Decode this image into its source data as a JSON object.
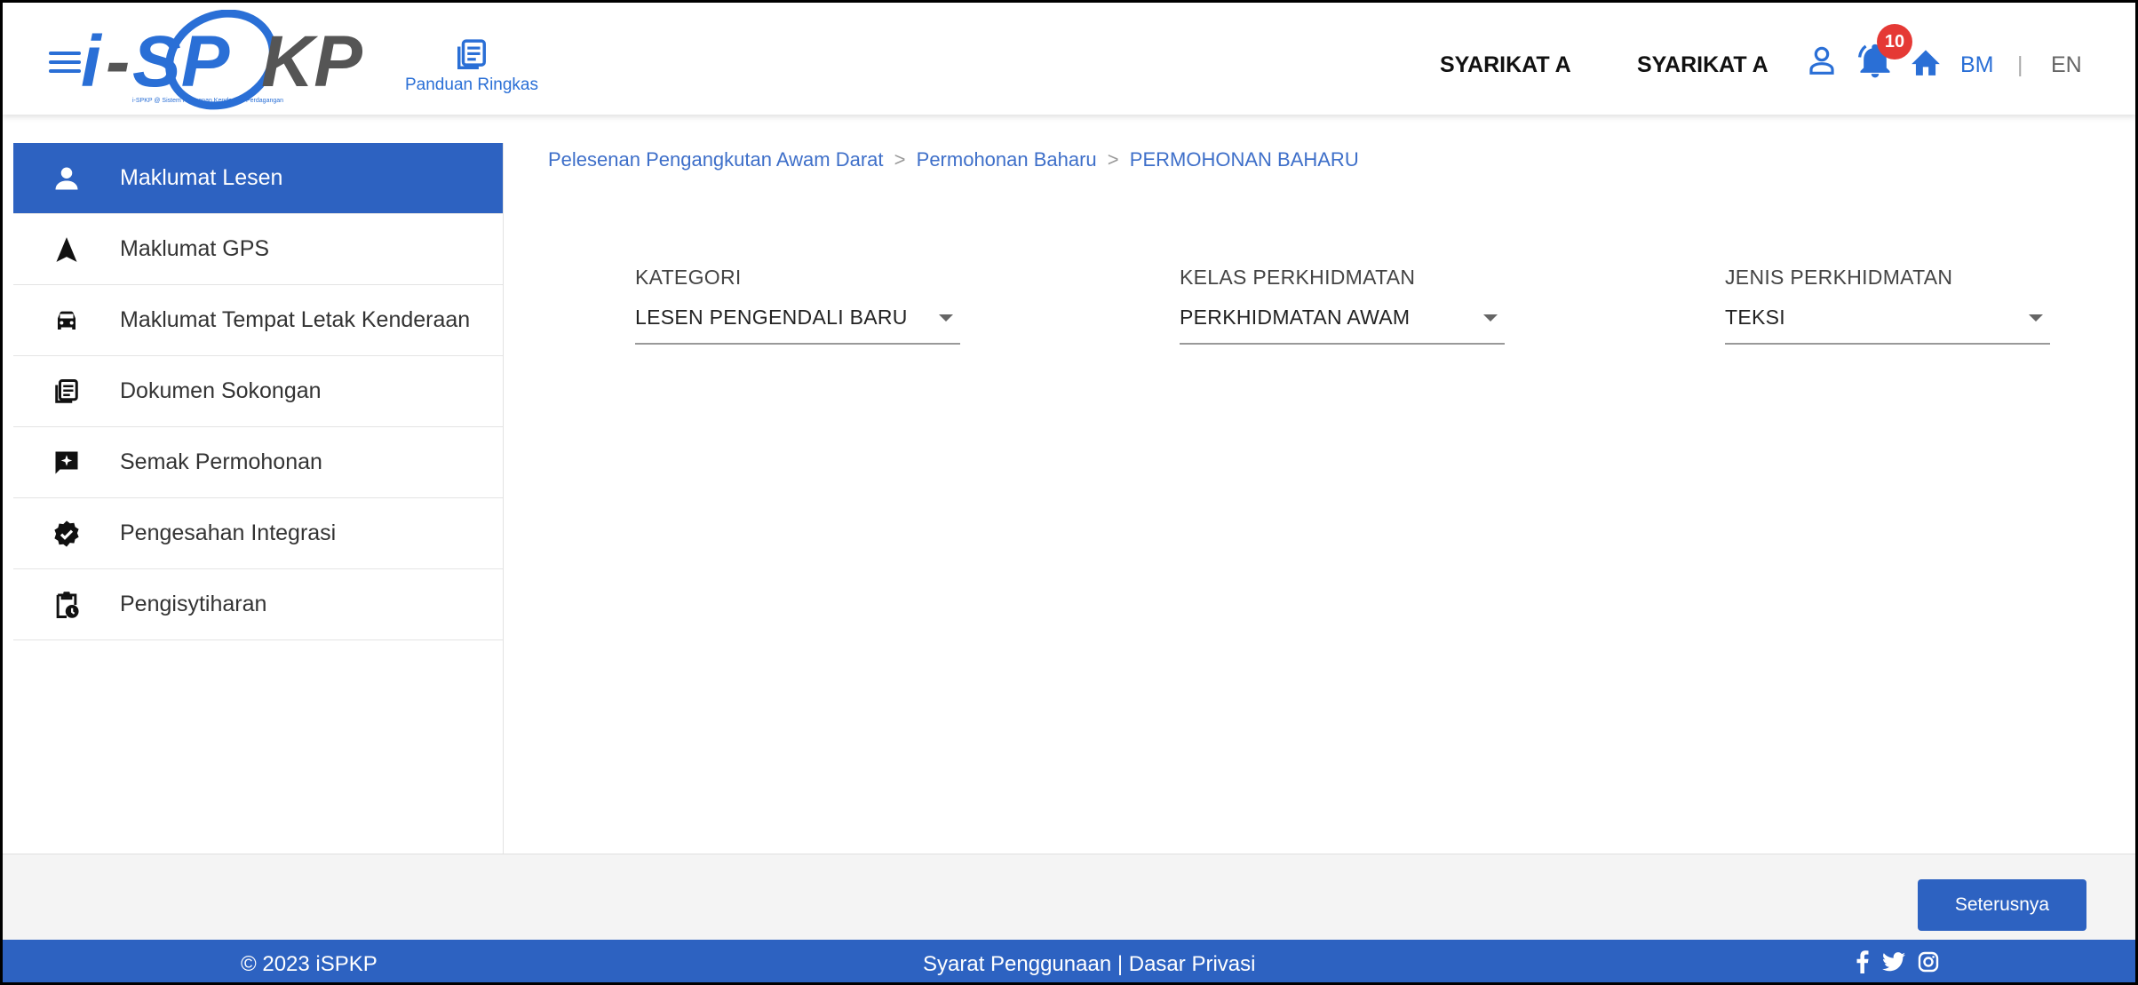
{
  "header": {
    "logo_text": "i-SPKP",
    "logo_tagline": "i-SPKP @ Sistem Pelesenan Kenderaan Perdagangan",
    "guide_label": "Panduan Ringkas",
    "company_1": "SYARIKAT A",
    "company_2": "SYARIKAT A",
    "notification_count": "10",
    "lang_bm": "BM",
    "lang_sep": "|",
    "lang_en": "EN"
  },
  "sidebar": {
    "items": [
      {
        "label": "Maklumat Lesen",
        "icon": "person-icon",
        "active": true
      },
      {
        "label": "Maklumat GPS",
        "icon": "navigation-icon",
        "active": false
      },
      {
        "label": "Maklumat Tempat Letak Kenderaan",
        "icon": "car-icon",
        "active": false
      },
      {
        "label": "Dokumen Sokongan",
        "icon": "document-icon",
        "active": false
      },
      {
        "label": "Semak Permohonan",
        "icon": "review-icon",
        "active": false
      },
      {
        "label": "Pengesahan Integrasi",
        "icon": "verified-icon",
        "active": false
      },
      {
        "label": "Pengisytiharan",
        "icon": "clipboard-clock-icon",
        "active": false
      }
    ]
  },
  "breadcrumb": {
    "level1": "Pelesenan Pengangkutan Awam Darat",
    "sep1": ">",
    "level2": "Permohonan Baharu",
    "sep2": ">",
    "level3": "PERMOHONAN BAHARU"
  },
  "form": {
    "kategori": {
      "label": "KATEGORI",
      "value": "LESEN PENGENDALI BARU"
    },
    "kelas": {
      "label": "KELAS PERKHIDMATAN",
      "value": "PERKHIDMATAN AWAM"
    },
    "jenis": {
      "label": "JENIS PERKHIDMATAN",
      "value": "TEKSI"
    }
  },
  "actions": {
    "next_label": "Seterusnya"
  },
  "footer": {
    "copyright": "© 2023 iSPKP",
    "terms": "Syarat Penggunaan",
    "terms_sep": "|",
    "privacy": "Dasar Privasi"
  },
  "colors": {
    "primary": "#2d62c1",
    "accent": "#2a6fd6",
    "badge": "#e53935"
  }
}
